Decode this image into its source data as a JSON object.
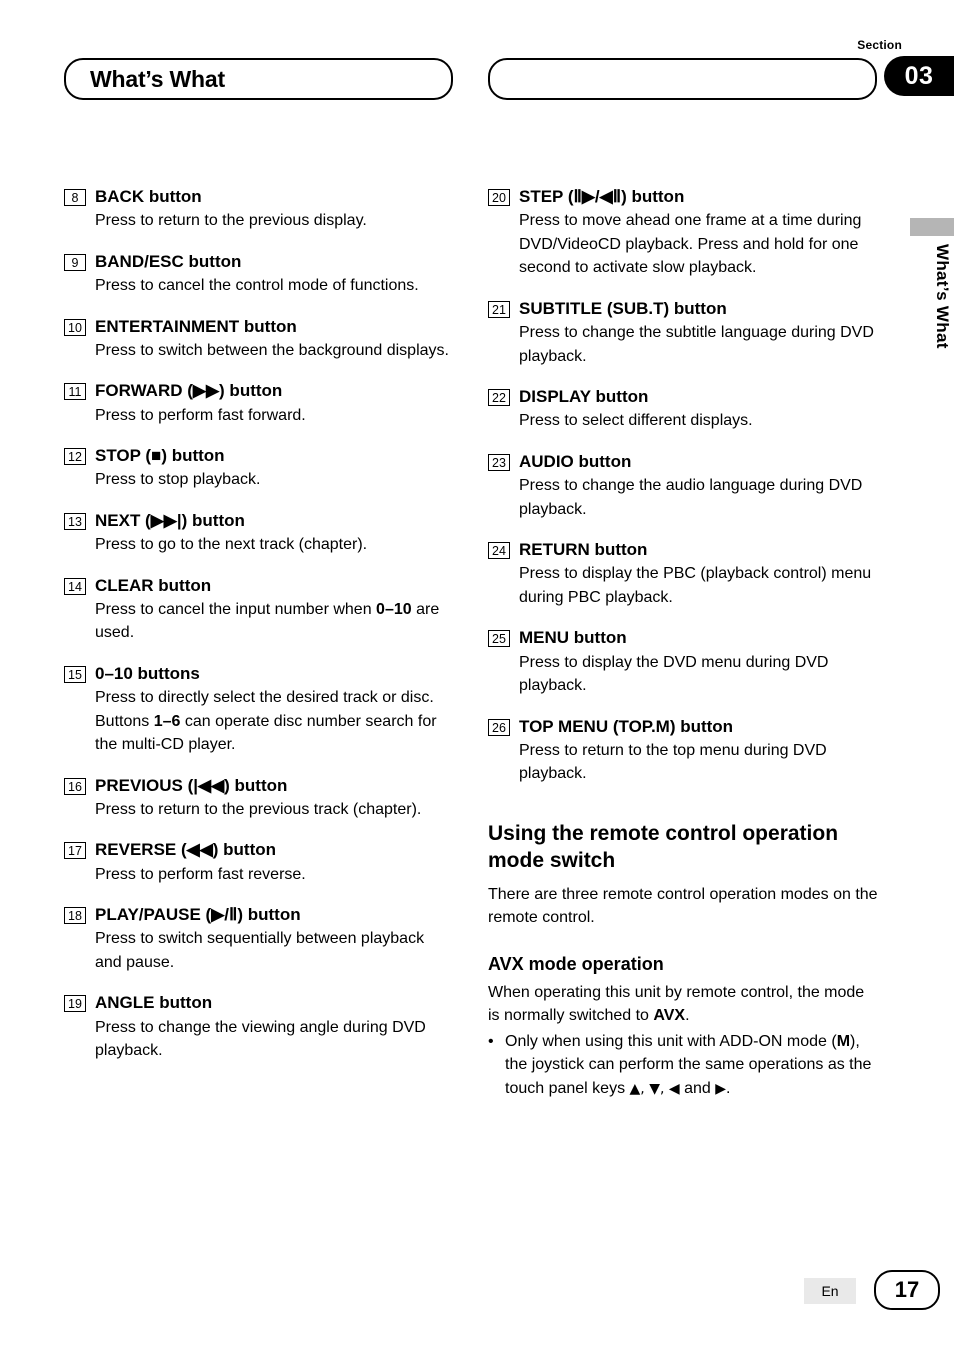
{
  "header": {
    "section_label": "Section",
    "section_number": "03",
    "chapter_title": "What’s What",
    "side_tab_text": "What’s What"
  },
  "left_column": [
    {
      "num": "8",
      "title": "BACK button",
      "body": "Press to return to the previous display."
    },
    {
      "num": "9",
      "title": "BAND/ESC button",
      "body": "Press to cancel the control mode of functions."
    },
    {
      "num": "10",
      "title": "ENTERTAINMENT button",
      "body": "Press to switch between the background displays."
    },
    {
      "num": "11",
      "title": "FORWARD (▶▶) button",
      "body": "Press to perform fast forward."
    },
    {
      "num": "12",
      "title": "STOP (■) button",
      "body": "Press to stop playback."
    },
    {
      "num": "13",
      "title": "NEXT (▶▶|) button",
      "body": "Press to go to the next track (chapter)."
    },
    {
      "num": "14",
      "title": "CLEAR button",
      "body_pre": "Press to cancel the input number when ",
      "body_bold": "0–10",
      "body_post": " are used."
    },
    {
      "num": "15",
      "title": "0–10 buttons",
      "body_pre": "Press to directly select the desired track or disc. Buttons ",
      "body_bold": "1–6",
      "body_post": " can operate disc number search for the multi-CD player."
    },
    {
      "num": "16",
      "title": "PREVIOUS (|◀◀) button",
      "body": "Press to return to the previous track (chapter)."
    },
    {
      "num": "17",
      "title": "REVERSE (◀◀) button",
      "body": "Press to perform fast reverse."
    },
    {
      "num": "18",
      "title": "PLAY/PAUSE (▶/Ⅱ) button",
      "body": "Press to switch sequentially between playback and pause."
    },
    {
      "num": "19",
      "title": "ANGLE button",
      "body": "Press to change the viewing angle during DVD playback."
    }
  ],
  "right_column": [
    {
      "num": "20",
      "title": "STEP (Ⅱ▶/◀Ⅱ) button",
      "body": "Press to move ahead one frame at a time during DVD/VideoCD playback. Press and hold for one second to activate slow playback."
    },
    {
      "num": "21",
      "title": "SUBTITLE (SUB.T) button",
      "body": "Press to change the subtitle language during DVD playback."
    },
    {
      "num": "22",
      "title": "DISPLAY button",
      "body": "Press to select different displays."
    },
    {
      "num": "23",
      "title": "AUDIO button",
      "body": "Press to change the audio language during DVD playback."
    },
    {
      "num": "24",
      "title": "RETURN button",
      "body": "Press to display the PBC (playback control) menu during PBC playback."
    },
    {
      "num": "25",
      "title": "MENU button",
      "body": "Press to display the DVD menu during DVD playback."
    },
    {
      "num": "26",
      "title": "TOP MENU (TOP.M) button",
      "body": "Press to return to the top menu during DVD playback."
    }
  ],
  "sections": {
    "heading_main": "Using the remote control operation mode switch",
    "heading_main_para": "There are three remote control operation modes on the remote control.",
    "heading_sub": "AVX mode operation",
    "sub_para_pre": "When operating this unit by remote control, the mode is normally switched to ",
    "sub_para_bold": "AVX",
    "sub_para_post": ".",
    "bullet_pre": "Only when using this unit with ADD-ON mode (",
    "bullet_bold": "M",
    "bullet_mid": "), the joystick can perform the same operations as the touch panel keys ",
    "bullet_keys": "▲, ▼, ◀",
    "bullet_and": " and ",
    "bullet_key_last": "▶",
    "bullet_end": "."
  },
  "footer": {
    "lang": "En",
    "page_number": "17"
  }
}
